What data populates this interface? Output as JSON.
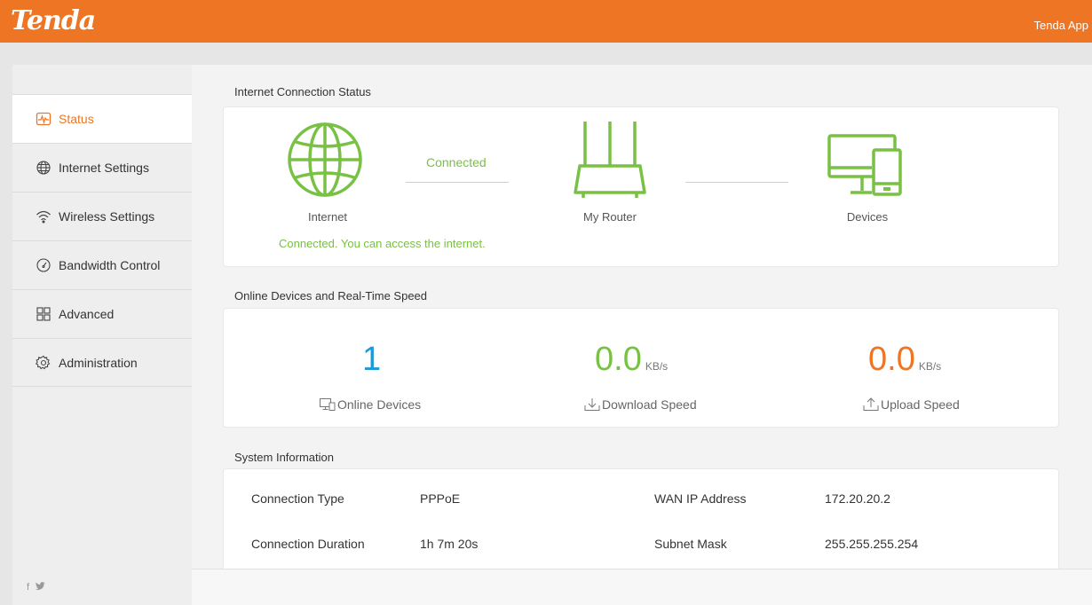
{
  "header": {
    "logo": "Tenda",
    "app_link": "Tenda App",
    "accent_color": "#ee7524"
  },
  "sidebar": {
    "items": [
      {
        "label": "Status",
        "icon": "status-pulse-icon",
        "active": true
      },
      {
        "label": "Internet Settings",
        "icon": "globe-icon",
        "active": false
      },
      {
        "label": "Wireless Settings",
        "icon": "wifi-icon",
        "active": false
      },
      {
        "label": "Bandwidth Control",
        "icon": "gauge-icon",
        "active": false
      },
      {
        "label": "Advanced",
        "icon": "grid-icon",
        "active": false
      },
      {
        "label": "Administration",
        "icon": "gear-icon",
        "active": false
      }
    ],
    "social": "f 🐦"
  },
  "connection_status": {
    "title": "Internet Connection Status",
    "internet_label": "Internet",
    "router_label": "My Router",
    "devices_label": "Devices",
    "link_status": "Connected",
    "message": "Connected. You can access the internet.",
    "status_color": "#79c144"
  },
  "realtime": {
    "title": "Online Devices and Real-Time Speed",
    "online_devices": {
      "value": "1",
      "label": "Online Devices",
      "color": "#1a9bd7"
    },
    "download": {
      "value": "0.0",
      "unit": "KB/s",
      "label": "Download Speed",
      "color": "#79c144"
    },
    "upload": {
      "value": "0.0",
      "unit": "KB/s",
      "label": "Upload Speed",
      "color": "#ee7524"
    }
  },
  "system_info": {
    "title": "System Information",
    "rows": [
      {
        "label": "Connection Type",
        "value": "PPPoE",
        "label2": "WAN IP Address",
        "value2": "172.20.20.2"
      },
      {
        "label": "Connection Duration",
        "value": "1h 7m 20s",
        "label2": "Subnet Mask",
        "value2": "255.255.255.254"
      }
    ]
  }
}
